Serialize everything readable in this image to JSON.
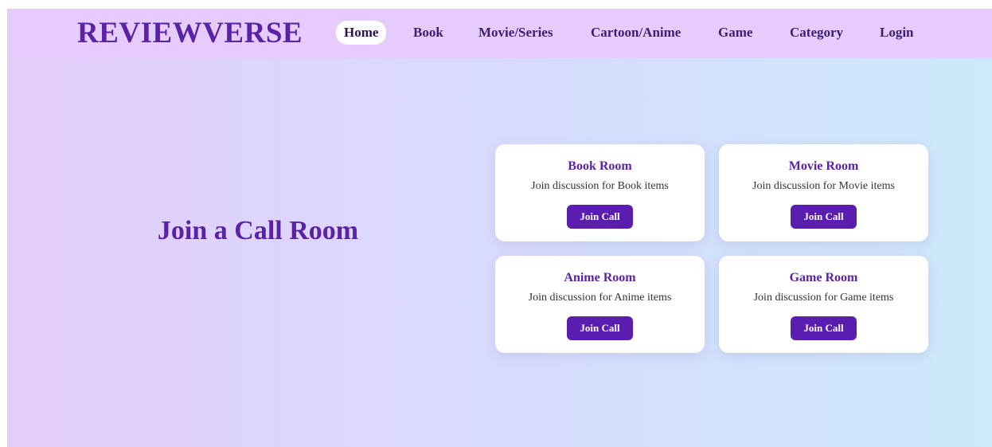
{
  "header": {
    "brand": "REVIEWVERSE",
    "nav": [
      {
        "label": "Home",
        "active": true
      },
      {
        "label": "Book"
      },
      {
        "label": "Movie/Series"
      },
      {
        "label": "Cartoon/Anime"
      },
      {
        "label": "Game"
      },
      {
        "label": "Category"
      },
      {
        "label": "Login"
      }
    ]
  },
  "main": {
    "title": "Join a Call Room",
    "rooms": [
      {
        "title": "Book Room",
        "description": "Join discussion for Book items",
        "button": "Join Call"
      },
      {
        "title": "Movie Room",
        "description": "Join discussion for Movie items",
        "button": "Join Call"
      },
      {
        "title": "Anime Room",
        "description": "Join discussion for Anime items",
        "button": "Join Call"
      },
      {
        "title": "Game Room",
        "description": "Join discussion for Game items",
        "button": "Join Call"
      }
    ]
  },
  "colors": {
    "brand": "#5b22a8",
    "button": "#5b1cb0",
    "navbar_bg": "#e5ccfd",
    "gradient_start": "#e4ccfb",
    "gradient_end": "#cde9fb"
  }
}
